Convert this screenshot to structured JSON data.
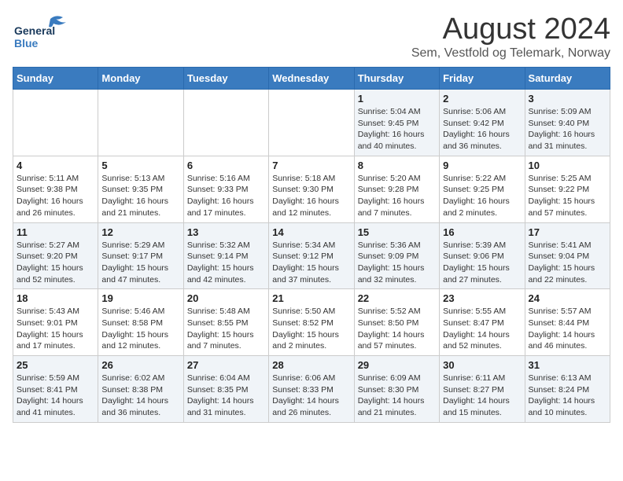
{
  "logo": {
    "line1": "General",
    "line2": "Blue"
  },
  "title": "August 2024",
  "subtitle": "Sem, Vestfold og Telemark, Norway",
  "days_of_week": [
    "Sunday",
    "Monday",
    "Tuesday",
    "Wednesday",
    "Thursday",
    "Friday",
    "Saturday"
  ],
  "weeks": [
    [
      {
        "day": "",
        "info": ""
      },
      {
        "day": "",
        "info": ""
      },
      {
        "day": "",
        "info": ""
      },
      {
        "day": "",
        "info": ""
      },
      {
        "day": "1",
        "info": "Sunrise: 5:04 AM\nSunset: 9:45 PM\nDaylight: 16 hours\nand 40 minutes."
      },
      {
        "day": "2",
        "info": "Sunrise: 5:06 AM\nSunset: 9:42 PM\nDaylight: 16 hours\nand 36 minutes."
      },
      {
        "day": "3",
        "info": "Sunrise: 5:09 AM\nSunset: 9:40 PM\nDaylight: 16 hours\nand 31 minutes."
      }
    ],
    [
      {
        "day": "4",
        "info": "Sunrise: 5:11 AM\nSunset: 9:38 PM\nDaylight: 16 hours\nand 26 minutes."
      },
      {
        "day": "5",
        "info": "Sunrise: 5:13 AM\nSunset: 9:35 PM\nDaylight: 16 hours\nand 21 minutes."
      },
      {
        "day": "6",
        "info": "Sunrise: 5:16 AM\nSunset: 9:33 PM\nDaylight: 16 hours\nand 17 minutes."
      },
      {
        "day": "7",
        "info": "Sunrise: 5:18 AM\nSunset: 9:30 PM\nDaylight: 16 hours\nand 12 minutes."
      },
      {
        "day": "8",
        "info": "Sunrise: 5:20 AM\nSunset: 9:28 PM\nDaylight: 16 hours\nand 7 minutes."
      },
      {
        "day": "9",
        "info": "Sunrise: 5:22 AM\nSunset: 9:25 PM\nDaylight: 16 hours\nand 2 minutes."
      },
      {
        "day": "10",
        "info": "Sunrise: 5:25 AM\nSunset: 9:22 PM\nDaylight: 15 hours\nand 57 minutes."
      }
    ],
    [
      {
        "day": "11",
        "info": "Sunrise: 5:27 AM\nSunset: 9:20 PM\nDaylight: 15 hours\nand 52 minutes."
      },
      {
        "day": "12",
        "info": "Sunrise: 5:29 AM\nSunset: 9:17 PM\nDaylight: 15 hours\nand 47 minutes."
      },
      {
        "day": "13",
        "info": "Sunrise: 5:32 AM\nSunset: 9:14 PM\nDaylight: 15 hours\nand 42 minutes."
      },
      {
        "day": "14",
        "info": "Sunrise: 5:34 AM\nSunset: 9:12 PM\nDaylight: 15 hours\nand 37 minutes."
      },
      {
        "day": "15",
        "info": "Sunrise: 5:36 AM\nSunset: 9:09 PM\nDaylight: 15 hours\nand 32 minutes."
      },
      {
        "day": "16",
        "info": "Sunrise: 5:39 AM\nSunset: 9:06 PM\nDaylight: 15 hours\nand 27 minutes."
      },
      {
        "day": "17",
        "info": "Sunrise: 5:41 AM\nSunset: 9:04 PM\nDaylight: 15 hours\nand 22 minutes."
      }
    ],
    [
      {
        "day": "18",
        "info": "Sunrise: 5:43 AM\nSunset: 9:01 PM\nDaylight: 15 hours\nand 17 minutes."
      },
      {
        "day": "19",
        "info": "Sunrise: 5:46 AM\nSunset: 8:58 PM\nDaylight: 15 hours\nand 12 minutes."
      },
      {
        "day": "20",
        "info": "Sunrise: 5:48 AM\nSunset: 8:55 PM\nDaylight: 15 hours\nand 7 minutes."
      },
      {
        "day": "21",
        "info": "Sunrise: 5:50 AM\nSunset: 8:52 PM\nDaylight: 15 hours\nand 2 minutes."
      },
      {
        "day": "22",
        "info": "Sunrise: 5:52 AM\nSunset: 8:50 PM\nDaylight: 14 hours\nand 57 minutes."
      },
      {
        "day": "23",
        "info": "Sunrise: 5:55 AM\nSunset: 8:47 PM\nDaylight: 14 hours\nand 52 minutes."
      },
      {
        "day": "24",
        "info": "Sunrise: 5:57 AM\nSunset: 8:44 PM\nDaylight: 14 hours\nand 46 minutes."
      }
    ],
    [
      {
        "day": "25",
        "info": "Sunrise: 5:59 AM\nSunset: 8:41 PM\nDaylight: 14 hours\nand 41 minutes."
      },
      {
        "day": "26",
        "info": "Sunrise: 6:02 AM\nSunset: 8:38 PM\nDaylight: 14 hours\nand 36 minutes."
      },
      {
        "day": "27",
        "info": "Sunrise: 6:04 AM\nSunset: 8:35 PM\nDaylight: 14 hours\nand 31 minutes."
      },
      {
        "day": "28",
        "info": "Sunrise: 6:06 AM\nSunset: 8:33 PM\nDaylight: 14 hours\nand 26 minutes."
      },
      {
        "day": "29",
        "info": "Sunrise: 6:09 AM\nSunset: 8:30 PM\nDaylight: 14 hours\nand 21 minutes."
      },
      {
        "day": "30",
        "info": "Sunrise: 6:11 AM\nSunset: 8:27 PM\nDaylight: 14 hours\nand 15 minutes."
      },
      {
        "day": "31",
        "info": "Sunrise: 6:13 AM\nSunset: 8:24 PM\nDaylight: 14 hours\nand 10 minutes."
      }
    ]
  ]
}
